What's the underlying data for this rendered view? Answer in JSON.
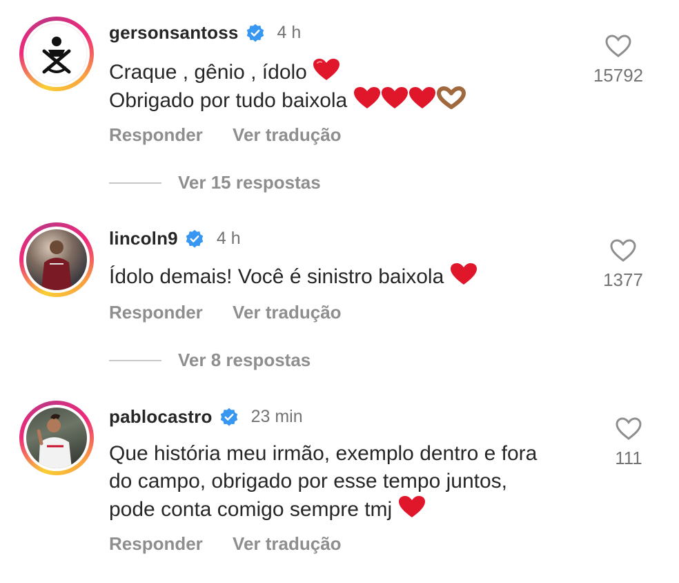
{
  "comments": [
    {
      "username": "gersonsantoss",
      "time": "4 h",
      "lines": [
        "Craque , gênio , ídolo",
        "Obrigado por tudo baixola"
      ],
      "likes": "15792",
      "reply_label": "Responder",
      "translate_label": "Ver tradução",
      "view_replies": "Ver 15 respostas"
    },
    {
      "username": "lincoln9",
      "time": "4 h",
      "lines": [
        "Ídolo demais! Você é sinistro baixola"
      ],
      "likes": "1377",
      "reply_label": "Responder",
      "translate_label": "Ver tradução",
      "view_replies": "Ver 8 respostas"
    },
    {
      "username": "pablocastro",
      "time": "23 min",
      "lines": [
        "Que história meu irmão, exemplo dentro e fora",
        "do campo, obrigado por esse tempo juntos,",
        "pode conta comigo sempre tmj"
      ],
      "likes": "111",
      "reply_label": "Responder",
      "translate_label": "Ver tradução"
    }
  ],
  "colors": {
    "verified": "#3897f0",
    "heart_emoji": "#e0162b",
    "muted": "#8e8e8e"
  },
  "icons": {
    "like": "heart-outline-icon",
    "verified": "verified-badge-icon"
  }
}
